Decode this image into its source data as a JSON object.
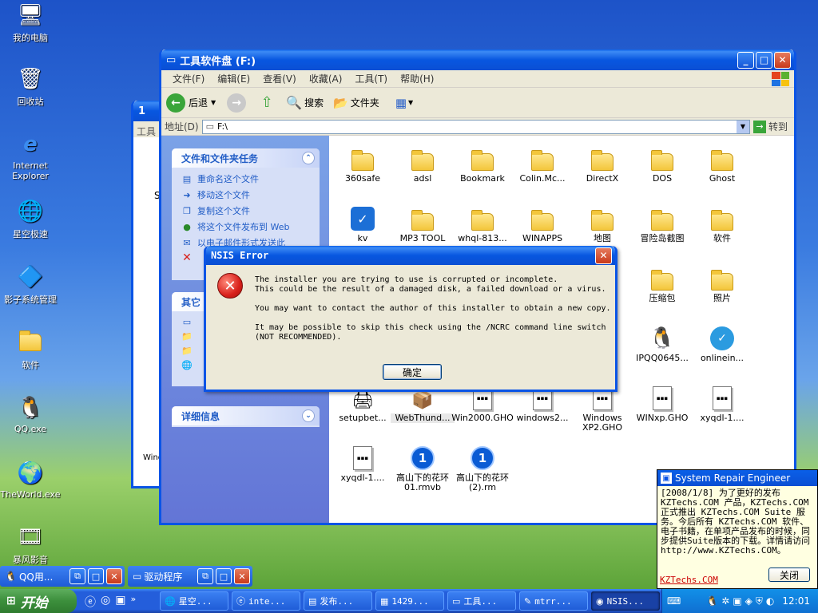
{
  "desktop_icons": [
    {
      "label": "我的电脑",
      "icon": "my-computer-icon"
    },
    {
      "label": "回收站",
      "icon": "recycle-bin-icon"
    },
    {
      "label": "Internet Explorer",
      "icon": "internet-explorer-icon"
    },
    {
      "label": "星空极速",
      "icon": "xingkong-icon"
    },
    {
      "label": "影子系统管理",
      "icon": "shadow-system-icon"
    },
    {
      "label": "软件",
      "icon": "folder-icon"
    },
    {
      "label": "QQ.exe",
      "icon": "qq-icon"
    },
    {
      "label": "TheWorld.exe",
      "icon": "theworld-icon"
    },
    {
      "label": "暴风影音",
      "icon": "baofeng-icon"
    }
  ],
  "back_window": {
    "title": "1",
    "menu": "工具",
    "letter": "S",
    "status": "Wind"
  },
  "explorer": {
    "title": "工具软件盘 (F:)",
    "menu": [
      "文件(F)",
      "编辑(E)",
      "查看(V)",
      "收藏(A)",
      "工具(T)",
      "帮助(H)"
    ],
    "toolbar": {
      "back": "后退",
      "search": "搜索",
      "folders": "文件夹"
    },
    "address_label": "地址(D)",
    "address_value": "F:\\",
    "go": "转到",
    "tasks_title": "文件和文件夹任务",
    "tasks": [
      {
        "label": "重命名这个文件",
        "icon": "rename-icon"
      },
      {
        "label": "移动这个文件",
        "icon": "move-icon"
      },
      {
        "label": "复制这个文件",
        "icon": "copy-icon"
      },
      {
        "label": "将这个文件发布到 Web",
        "icon": "publish-web-icon"
      },
      {
        "label": "以电子邮件形式发送此",
        "icon": "email-icon"
      },
      {
        "label": "",
        "icon": "delete-icon"
      }
    ],
    "other_title": "其它",
    "details_title": "详细信息",
    "files": [
      {
        "name": "360safe",
        "type": "folder"
      },
      {
        "name": "adsl",
        "type": "folder"
      },
      {
        "name": "Bookmark",
        "type": "folder"
      },
      {
        "name": "Colin.Mc...",
        "type": "folder"
      },
      {
        "name": "DirectX",
        "type": "folder"
      },
      {
        "name": "DOS",
        "type": "folder"
      },
      {
        "name": "Ghost",
        "type": "folder"
      },
      {
        "name": "kv",
        "type": "kv"
      },
      {
        "name": "MP3 TOOL",
        "type": "folder"
      },
      {
        "name": "whql-813...",
        "type": "folder"
      },
      {
        "name": "WINAPPS",
        "type": "folder"
      },
      {
        "name": "地图",
        "type": "folder"
      },
      {
        "name": "冒险岛截图",
        "type": "folder"
      },
      {
        "name": "软件",
        "type": "folder"
      },
      {
        "name": "",
        "type": "hidden"
      },
      {
        "name": "",
        "type": "hidden"
      },
      {
        "name": "",
        "type": "hidden"
      },
      {
        "name": "",
        "type": "hidden"
      },
      {
        "name": "夹",
        "type": "hidden"
      },
      {
        "name": "压缩包",
        "type": "folder"
      },
      {
        "name": "照片",
        "type": "folder"
      },
      {
        "name": "",
        "type": "hidden"
      },
      {
        "name": "",
        "type": "hidden"
      },
      {
        "name": "",
        "type": "hidden"
      },
      {
        "name": "",
        "type": "hidden"
      },
      {
        "name": "1",
        "type": "hidden"
      },
      {
        "name": "IPQQ0645...",
        "type": "qq"
      },
      {
        "name": "onlinein...",
        "type": "online"
      },
      {
        "name": "setupbet...",
        "type": "setup"
      },
      {
        "name": "WebThund...",
        "type": "webthunder"
      },
      {
        "name": "Win2000.GHO",
        "type": "gho"
      },
      {
        "name": "windows2...",
        "type": "gho"
      },
      {
        "name": "Windows XP2.GHO",
        "type": "gho"
      },
      {
        "name": "WINxp.GHO",
        "type": "gho"
      },
      {
        "name": "xyqdl-1....",
        "type": "gho"
      },
      {
        "name": "xyqdl-1....",
        "type": "gho"
      },
      {
        "name": "高山下的花环01.rmvb",
        "type": "real"
      },
      {
        "name": "高山下的花环(2).rm",
        "type": "real"
      }
    ]
  },
  "dialog": {
    "title": "NSIS Error",
    "message": "The installer you are trying to use is corrupted or incomplete.\nThis could be the result of a damaged disk, a failed download or a virus.\n\nYou may want to contact the author of this installer to obtain a new copy.\n\nIt may be possible to skip this check using the /NCRC command line switch\n(NOT RECOMMENDED).",
    "ok": "确定"
  },
  "notification": {
    "title": "System Repair Engineer",
    "body": "[2008/1/8] 为了更好的发布 KZTechs.COM 产品，KZTechs.COM 正式推出 KZTechs.COM Suite 服务。今后所有 KZTechs.COM 软件、电子书籍，在单项产品发布的时候，同步提供Suite版本的下载。详情请访问 http://www.KZTechs.COM。",
    "link": "KZTechs.COM",
    "close": "关闭"
  },
  "taskbar": {
    "start": "开始",
    "group1": "QQ用...",
    "group2": "驱动程序",
    "items": [
      "星空...",
      "inte...",
      "发布...",
      "1429...",
      "工具...",
      "mtrr...",
      "NSIS..."
    ],
    "clock": "12:01"
  },
  "colors": {
    "title_blue": "#0a54e6",
    "error_red": "#d8201b",
    "start_green": "#3c8f3c"
  }
}
